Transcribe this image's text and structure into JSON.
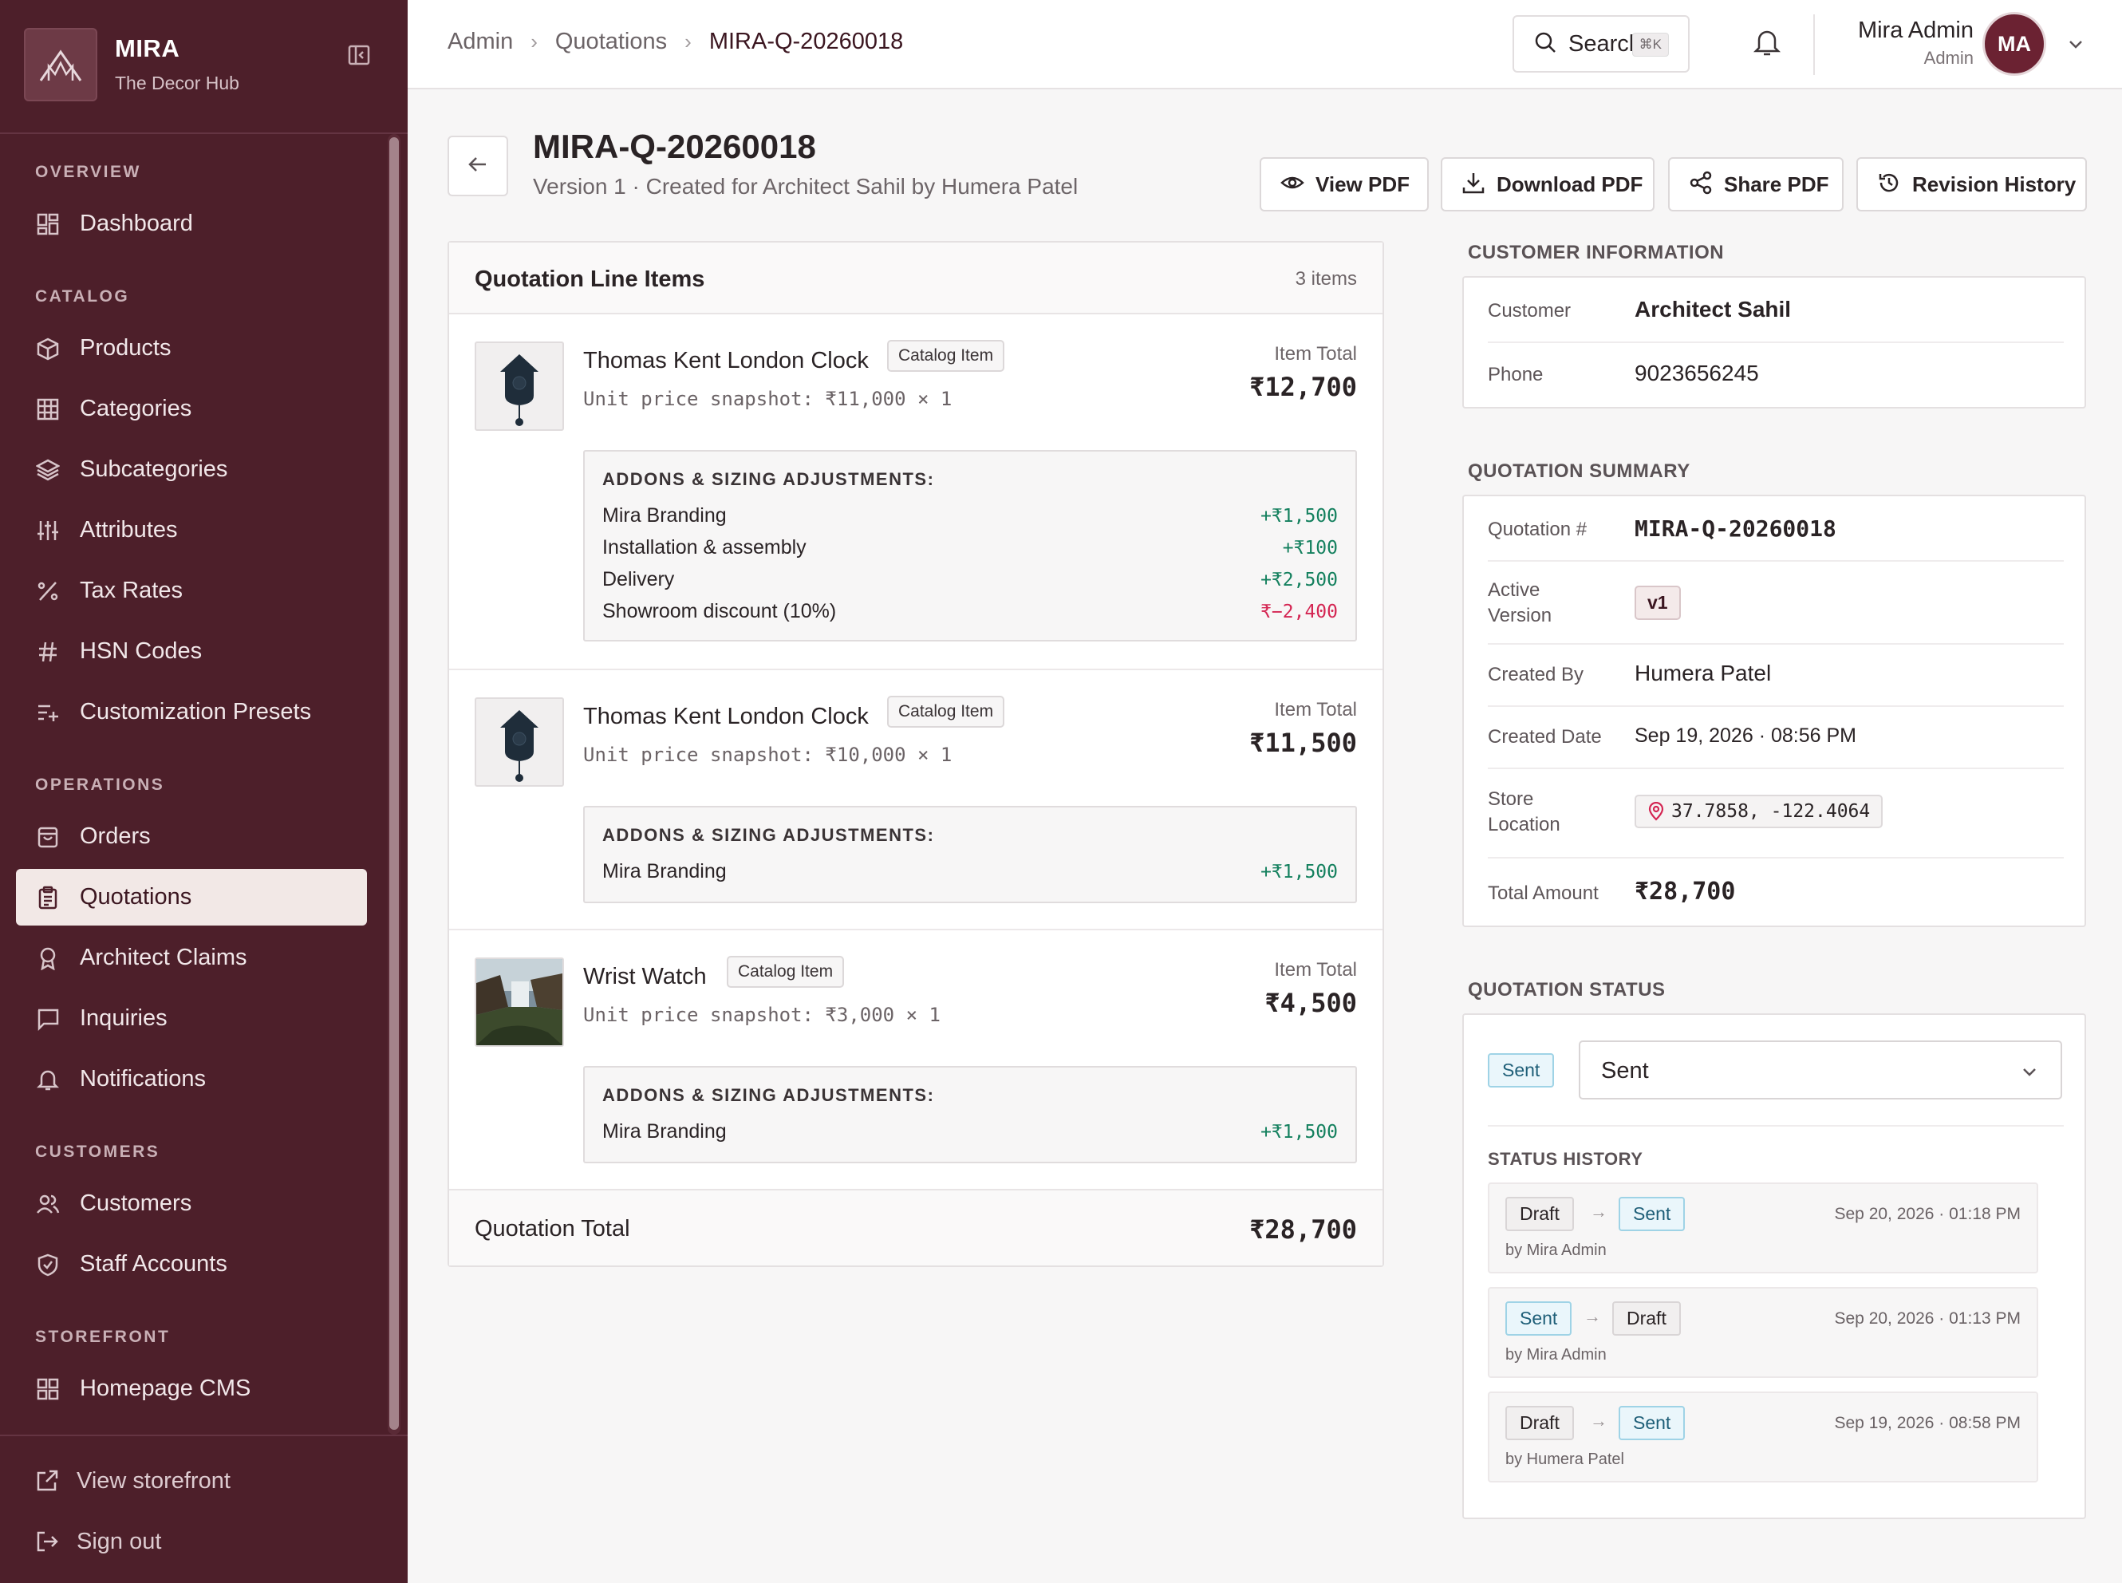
{
  "brand": {
    "name": "MIRA",
    "subtitle": "The Decor Hub"
  },
  "sidebar": {
    "sections": [
      {
        "label": "OVERVIEW",
        "items": [
          {
            "label": "Dashboard",
            "icon": "grid-icon"
          }
        ]
      },
      {
        "label": "CATALOG",
        "items": [
          {
            "label": "Products",
            "icon": "box-icon"
          },
          {
            "label": "Categories",
            "icon": "table-icon"
          },
          {
            "label": "Subcategories",
            "icon": "layers-icon"
          },
          {
            "label": "Attributes",
            "icon": "sliders-icon"
          },
          {
            "label": "Tax Rates",
            "icon": "percent-icon"
          },
          {
            "label": "HSN Codes",
            "icon": "hash-icon"
          },
          {
            "label": "Customization Presets",
            "icon": "list-plus-icon"
          }
        ]
      },
      {
        "label": "OPERATIONS",
        "items": [
          {
            "label": "Orders",
            "icon": "bag-icon"
          },
          {
            "label": "Quotations",
            "icon": "clipboard-icon",
            "active": true
          },
          {
            "label": "Architect Claims",
            "icon": "award-icon"
          },
          {
            "label": "Inquiries",
            "icon": "message-icon"
          },
          {
            "label": "Notifications",
            "icon": "bell-icon"
          }
        ]
      },
      {
        "label": "CUSTOMERS",
        "items": [
          {
            "label": "Customers",
            "icon": "users-icon"
          },
          {
            "label": "Staff Accounts",
            "icon": "shield-icon"
          }
        ]
      },
      {
        "label": "STOREFRONT",
        "items": [
          {
            "label": "Homepage CMS",
            "icon": "grid-icon"
          }
        ]
      }
    ],
    "footer": {
      "view_storefront": "View storefront",
      "sign_out": "Sign out"
    }
  },
  "topbar": {
    "breadcrumb": [
      "Admin",
      "Quotations",
      "MIRA-Q-20260018"
    ],
    "search_label": "Search",
    "search_shortcut": "⌘K",
    "user_name": "Mira Admin",
    "user_role": "Admin",
    "user_initials": "MA"
  },
  "header": {
    "title": "MIRA-Q-20260018",
    "subtitle": "Version 1 · Created for Architect Sahil by Humera Patel",
    "buttons": {
      "view_pdf": "View PDF",
      "download_pdf": "Download PDF",
      "share_pdf": "Share PDF",
      "revision_history": "Revision History"
    }
  },
  "line_items": {
    "title": "Quotation Line Items",
    "count": "3 items",
    "total_label": "Item Total",
    "addons_heading": "ADDONS & SIZING ADJUSTMENTS:",
    "badge": "Catalog Item",
    "items": [
      {
        "name": "Thomas Kent London Clock",
        "thumb": "clock",
        "unit": "Unit price snapshot: ₹11,000 × 1",
        "total": "₹12,700",
        "addons": [
          {
            "name": "Mira Branding",
            "value": "+₹1,500",
            "sign": "pos"
          },
          {
            "name": "Installation & assembly",
            "value": "+₹100",
            "sign": "pos"
          },
          {
            "name": "Delivery",
            "value": "+₹2,500",
            "sign": "pos"
          },
          {
            "name": "Showroom discount (10%)",
            "value": "₹−2,400",
            "sign": "neg"
          }
        ]
      },
      {
        "name": "Thomas Kent London Clock",
        "thumb": "clock",
        "unit": "Unit price snapshot: ₹10,000 × 1",
        "total": "₹11,500",
        "addons": [
          {
            "name": "Mira Branding",
            "value": "+₹1,500",
            "sign": "pos"
          }
        ]
      },
      {
        "name": "Wrist Watch",
        "thumb": "landscape",
        "unit": "Unit price snapshot: ₹3,000 × 1",
        "total": "₹4,500",
        "addons": [
          {
            "name": "Mira Branding",
            "value": "+₹1,500",
            "sign": "pos"
          }
        ]
      }
    ],
    "footer_label": "Quotation Total",
    "footer_total": "₹28,700"
  },
  "customer": {
    "section_title": "CUSTOMER INFORMATION",
    "customer_label": "Customer",
    "customer_value": "Architect Sahil",
    "phone_label": "Phone",
    "phone_value": "9023656245"
  },
  "summary": {
    "section_title": "QUOTATION SUMMARY",
    "quotation_label": "Quotation #",
    "quotation_value": "MIRA-Q-20260018",
    "version_label": "Active Version",
    "version_value": "v1",
    "created_by_label": "Created By",
    "created_by_value": "Humera Patel",
    "created_date_label": "Created Date",
    "created_date_value": "Sep 19, 2026 · 08:56 PM",
    "location_label": "Store Location",
    "location_value": "37.7858, -122.4064",
    "total_label": "Total Amount",
    "total_value": "₹28,700"
  },
  "status": {
    "section_title": "QUOTATION STATUS",
    "current_chip": "Sent",
    "select_value": "Sent",
    "history_title": "STATUS HISTORY",
    "history": [
      {
        "from": "Draft",
        "to": "Sent",
        "by": "by Mira Admin",
        "time": "Sep 20, 2026 · 01:18 PM"
      },
      {
        "from": "Sent",
        "to": "Draft",
        "by": "by Mira Admin",
        "time": "Sep 20, 2026 · 01:13 PM"
      },
      {
        "from": "Draft",
        "to": "Sent",
        "by": "by Humera Patel",
        "time": "Sep 19, 2026 · 08:58 PM"
      }
    ]
  },
  "colors": {
    "sidebar_bg": "#4d1f2a",
    "accent": "#6b2232",
    "positive": "#14805e",
    "negative": "#d42552",
    "sent": "#1f5f78"
  }
}
